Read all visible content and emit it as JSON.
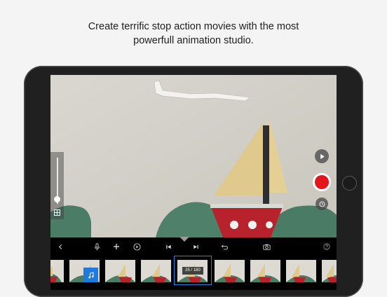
{
  "caption": {
    "line1": "Create terrific stop action movies with the most",
    "line2": "powerfull animation studio."
  },
  "colors": {
    "record": "#e3151a",
    "selection": "#2b7fe0",
    "music_badge": "#1f7ae0",
    "sail": "#e0c98d",
    "hull": "#b8222d",
    "hills": "#4b7d66"
  },
  "zoom": {
    "level": 0.1
  },
  "toolbar": {
    "icons": [
      "back-icon",
      "microphone-icon",
      "add-icon",
      "play-circle-icon",
      "skip-to-start-icon",
      "skip-to-end-icon",
      "undo-icon",
      "camera-icon",
      "help-icon"
    ]
  },
  "filmstrip": {
    "frame_counter": "25 / 160",
    "frames": 8
  }
}
